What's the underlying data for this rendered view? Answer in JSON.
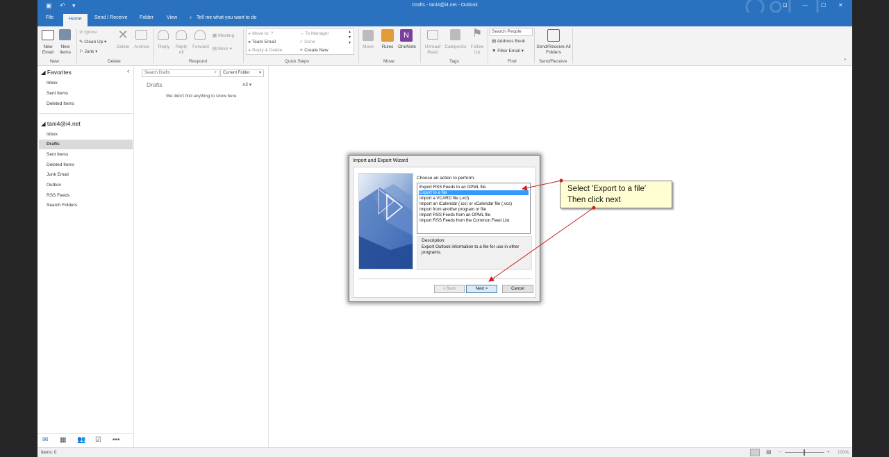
{
  "window": {
    "title": "Drafts - tani4@i4.net - Outlook"
  },
  "tabs": [
    "File",
    "Home",
    "Send / Receive",
    "Folder",
    "View"
  ],
  "tell_me": "Tell me what you want to do",
  "ribbon": {
    "new_email": "New Email",
    "new_items": "New Items",
    "ignore": "Ignore",
    "clean_up": "Clean Up",
    "junk": "Junk",
    "delete": "Delete",
    "archive": "Archive",
    "reply": "Reply",
    "reply_all": "Reply All",
    "forward": "Forward",
    "meeting": "Meeting",
    "more": "More",
    "quick_steps": [
      "Move to: ?",
      "Team Email",
      "Reply & Delete",
      "To Manager",
      "Done",
      "Create New"
    ],
    "move": "Move",
    "rules": "Rules",
    "onenote": "OneNote",
    "unread_read": "Unread/ Read",
    "categorize": "Categorize",
    "follow_up": "Follow Up",
    "search_people": "Search People",
    "address_book": "Address Book",
    "filter_email": "Filter Email",
    "send_receive_all": "Send/Receive All Folders",
    "groups": [
      "New",
      "Delete",
      "Respond",
      "Quick Steps",
      "Move",
      "Tags",
      "Find",
      "Send/Receive"
    ]
  },
  "folder_pane": {
    "favorites_header": "Favorites",
    "favorites": [
      "Inbox",
      "Sent Items",
      "Deleted Items"
    ],
    "account": "tani4@i4.net",
    "folders": [
      "Inbox",
      "Drafts",
      "Sent Items",
      "Deleted Items",
      "Junk Email",
      "Outbox",
      "RSS Feeds",
      "Search Folders"
    ],
    "selected_folder": "Drafts"
  },
  "message_list": {
    "search_placeholder": "Search Drafts",
    "scope": "Current Folder",
    "folder_title": "Drafts",
    "filter": "All",
    "empty_text": "We didn't find anything to show here."
  },
  "status_bar": {
    "items": "Items: 0",
    "zoom": "100%"
  },
  "dialog": {
    "title": "Import and Export Wizard",
    "prompt": "Choose an action to perform:",
    "actions": [
      "Export RSS Feeds to an OPML file",
      "Export to a file",
      "Import a VCARD file (.vcf)",
      "Import an iCalendar (.ics) or vCalendar file (.vcs)",
      "Import from another program or file",
      "Import RSS Feeds from an OPML file",
      "Import RSS Feeds from the Common Feed List"
    ],
    "selected_index": 1,
    "description_label": "Description",
    "description_text": "Export Outlook information to a file for use in other programs.",
    "back": "< Back",
    "next": "Next >",
    "cancel": "Cancel"
  },
  "callout": {
    "line1": "Select 'Export to a file'",
    "line2": "Then click next"
  },
  "colors": {
    "accent": "#2a72c0",
    "selection": "#3399ff",
    "callout_bg": "#fffed3",
    "arrow": "#cc1f1f"
  }
}
